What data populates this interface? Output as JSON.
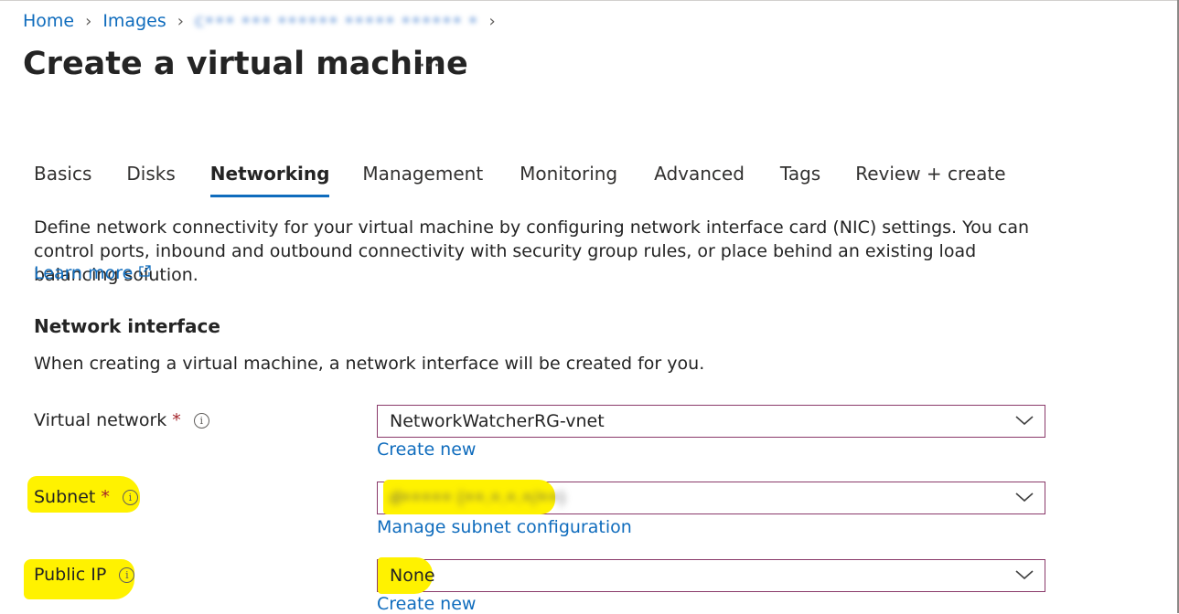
{
  "breadcrumb": {
    "items": [
      "Home",
      "Images"
    ],
    "current_redacted": "c••• ••• •••••• ••••• •••••• •"
  },
  "page": {
    "title": "Create a virtual machine",
    "more_label": "···"
  },
  "tabs": [
    {
      "label": "Basics",
      "active": false
    },
    {
      "label": "Disks",
      "active": false
    },
    {
      "label": "Networking",
      "active": true
    },
    {
      "label": "Management",
      "active": false
    },
    {
      "label": "Monitoring",
      "active": false
    },
    {
      "label": "Advanced",
      "active": false
    },
    {
      "label": "Tags",
      "active": false
    },
    {
      "label": "Review + create",
      "active": false
    }
  ],
  "intro": {
    "text": "Define network connectivity for your virtual machine by configuring network interface card (NIC) settings. You can control ports, inbound and outbound connectivity with security group rules, or place behind an existing load balancing solution.",
    "learn_more": "Learn more"
  },
  "network_interface": {
    "title": "Network interface",
    "description": "When creating a virtual machine, a network interface will be created for you."
  },
  "form": {
    "virtual_network": {
      "label": "Virtual network",
      "required": "*",
      "value": "NetworkWatcherRG-vnet",
      "link": "Create new"
    },
    "subnet": {
      "label": "Subnet",
      "required": "*",
      "value_redacted": "d••••• (••.•.•.•/••)",
      "link": "Manage subnet configuration"
    },
    "public_ip": {
      "label": "Public IP",
      "value": "None",
      "link": "Create new"
    }
  },
  "colors": {
    "link": "#0f6cbd",
    "highlight": "#fff200",
    "required": "#a4262c",
    "dropdown_border": "#8a3a6a"
  },
  "icons": [
    "chevron-right-icon",
    "external-link-icon",
    "info-icon",
    "chevron-down-icon"
  ]
}
